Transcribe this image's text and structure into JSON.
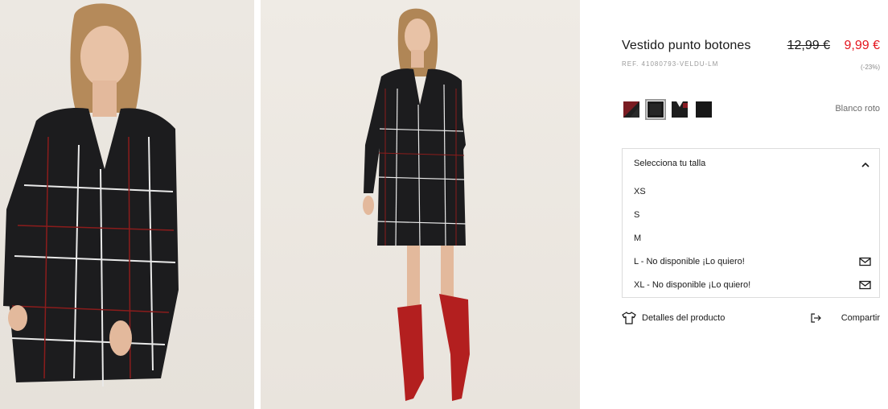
{
  "product": {
    "title": "Vestido punto botones",
    "old_price": "12,99 €",
    "new_price": "9,99 €",
    "reference": "REF. 41080793-VELDU-LM",
    "discount": "(-23%)"
  },
  "colors": {
    "selected_name": "Blanco roto",
    "swatches": [
      {
        "name": "black-red-swatch",
        "selected": false
      },
      {
        "name": "black-swatch",
        "selected": true
      },
      {
        "name": "black-red-print-swatch",
        "selected": false
      },
      {
        "name": "black-plain-swatch",
        "selected": false
      }
    ],
    "accent_price": "#e4161f"
  },
  "size_selector": {
    "header": "Selecciona tu talla",
    "options": [
      {
        "label": "XS",
        "available": true
      },
      {
        "label": "S",
        "available": true
      },
      {
        "label": "M",
        "available": true
      },
      {
        "label": "L - No disponible ¡Lo quiero!",
        "available": false
      },
      {
        "label": "XL - No disponible ¡Lo quiero!",
        "available": false
      }
    ]
  },
  "actions": {
    "details_label": "Detalles del producto",
    "share_label": "Compartir"
  }
}
